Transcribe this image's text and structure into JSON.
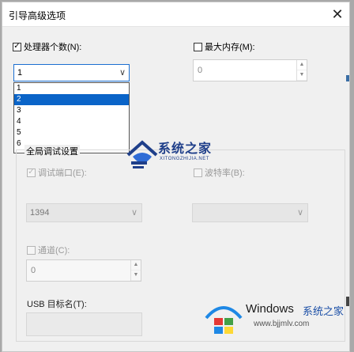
{
  "window": {
    "title": "引导高级选项",
    "close_glyph": "✕"
  },
  "processors": {
    "label": "处理器个数(N):",
    "checked": true,
    "value": "1",
    "options": [
      "1",
      "2",
      "3",
      "4",
      "5",
      "6"
    ],
    "selected_index": 1,
    "side_digits": "1 2 3 4 5 6"
  },
  "max_memory": {
    "label": "最大内存(M):",
    "checked": false,
    "value": "0"
  },
  "global_debug": {
    "title": "全局调试设置",
    "debug_port": {
      "label": "调试端口(E):",
      "checked": true,
      "value": "1394"
    },
    "baud_rate": {
      "label": "波特率(B):",
      "checked": false
    },
    "channel": {
      "label": "通道(C):",
      "checked": false,
      "value": "0"
    },
    "usb_target": {
      "label": "USB 目标名(T):"
    }
  },
  "watermarks": {
    "logo1_title": "系统之家",
    "logo1_sub": "XITONGZHIJIA.NET",
    "logo2_title": "Windows",
    "logo2_cn": "系统之家",
    "logo2_url": "www.bjjmlv.com"
  },
  "colors": {
    "accent": "#0a64c8",
    "border_focus": "#1b6fd1",
    "brand_blue": "#1f3f8a"
  }
}
